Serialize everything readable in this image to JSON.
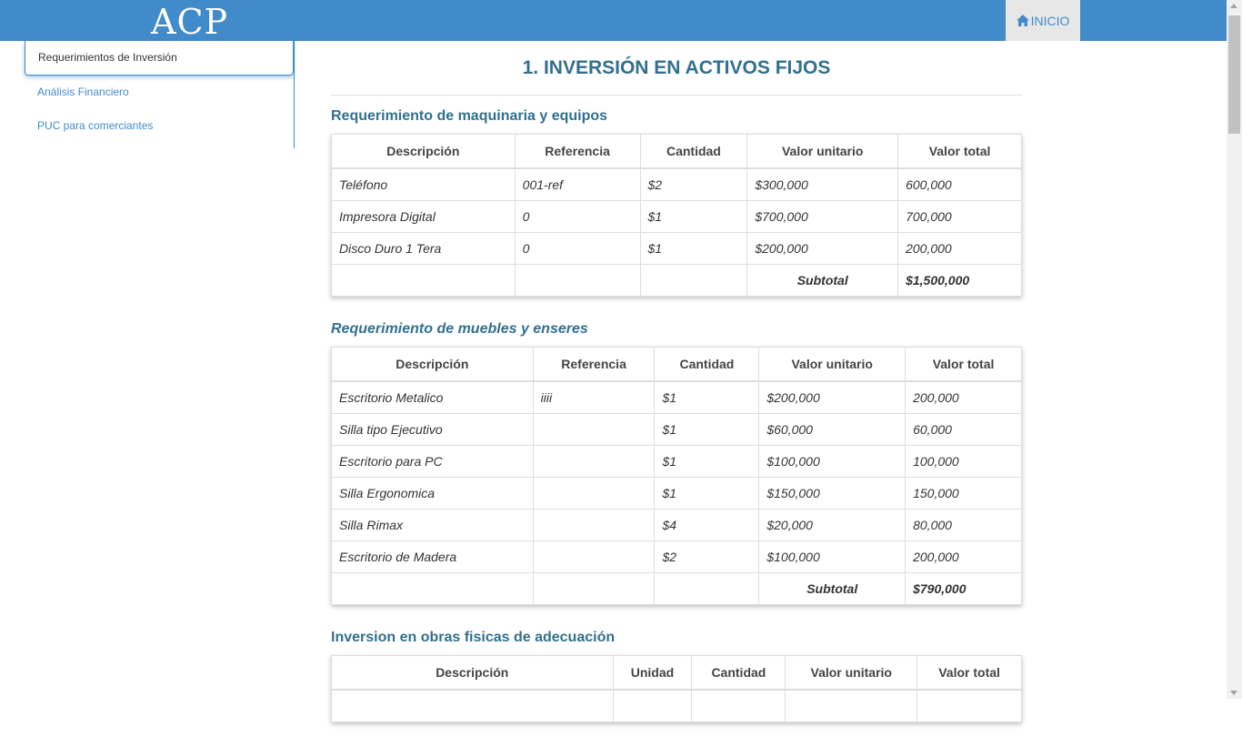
{
  "header": {
    "logo": "ACP",
    "home_label": "INICIO"
  },
  "sidebar": {
    "items": [
      {
        "label": "Requerimientos de Inversión"
      },
      {
        "label": "Análisis Financiero"
      },
      {
        "label": "PUC para comerciantes"
      }
    ]
  },
  "page": {
    "title": "1. INVERSIÓN EN ACTIVOS FIJOS"
  },
  "machinery": {
    "title": "Requerimiento de maquinaria y equipos",
    "headers": [
      "Descripción",
      "Referencia",
      "Cantidad",
      "Valor unitario",
      "Valor total"
    ],
    "rows": [
      [
        "Teléfono",
        "001-ref",
        "$2",
        "$300,000",
        "600,000"
      ],
      [
        "Impresora Digital",
        "0",
        "$1",
        "$700,000",
        "700,000"
      ],
      [
        "Disco Duro 1 Tera",
        "0",
        "$1",
        "$200,000",
        "200,000"
      ]
    ],
    "subtotal_label": "Subtotal",
    "subtotal_value": "$1,500,000"
  },
  "furniture": {
    "title": "Requerimiento de muebles y enseres",
    "headers": [
      "Descripción",
      "Referencia",
      "Cantidad",
      "Valor unitario",
      "Valor total"
    ],
    "rows": [
      [
        "Escritorio Metalico",
        "iiii",
        "$1",
        "$200,000",
        "200,000"
      ],
      [
        "Silla tipo Ejecutivo",
        "",
        "$1",
        "$60,000",
        "60,000"
      ],
      [
        "Escritorio para PC",
        "",
        "$1",
        "$100,000",
        "100,000"
      ],
      [
        "Silla Ergonomica",
        "",
        "$1",
        "$150,000",
        "150,000"
      ],
      [
        "Silla Rimax",
        "",
        "$4",
        "$20,000",
        "80,000"
      ],
      [
        "Escritorio de Madera",
        "",
        "$2",
        "$100,000",
        "200,000"
      ]
    ],
    "subtotal_label": "Subtotal",
    "subtotal_value": "$790,000"
  },
  "works": {
    "title": "Inversion en obras fisicas de adecuación",
    "headers": [
      "Descripción",
      "Unidad",
      "Cantidad",
      "Valor unitario",
      "Valor total"
    ]
  },
  "colors": {
    "accent": "#428bca",
    "title": "#31708f",
    "subtotal": "#a94442"
  }
}
